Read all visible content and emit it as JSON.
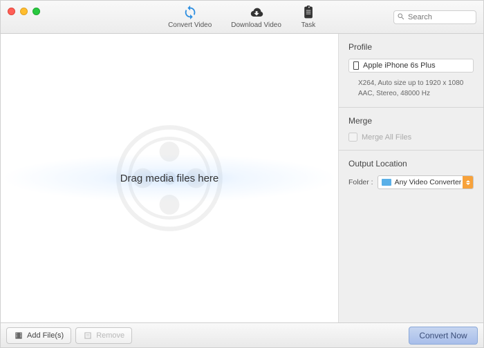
{
  "toolbar": {
    "convert_video": "Convert Video",
    "download_video": "Download Video",
    "task": "Task"
  },
  "search": {
    "placeholder": "Search"
  },
  "drop": {
    "text": "Drag media files here"
  },
  "sidebar": {
    "profile": {
      "title": "Profile",
      "device": "Apple iPhone 6s Plus",
      "detail1": "X264, Auto size up to 1920 x 1080",
      "detail2": "AAC, Stereo, 48000 Hz"
    },
    "merge": {
      "title": "Merge",
      "checkbox_label": "Merge All Files"
    },
    "output": {
      "title": "Output Location",
      "label": "Folder :",
      "value": "Any Video Converter"
    }
  },
  "bottom": {
    "add_files": "Add File(s)",
    "remove": "Remove",
    "convert_now": "Convert Now"
  }
}
